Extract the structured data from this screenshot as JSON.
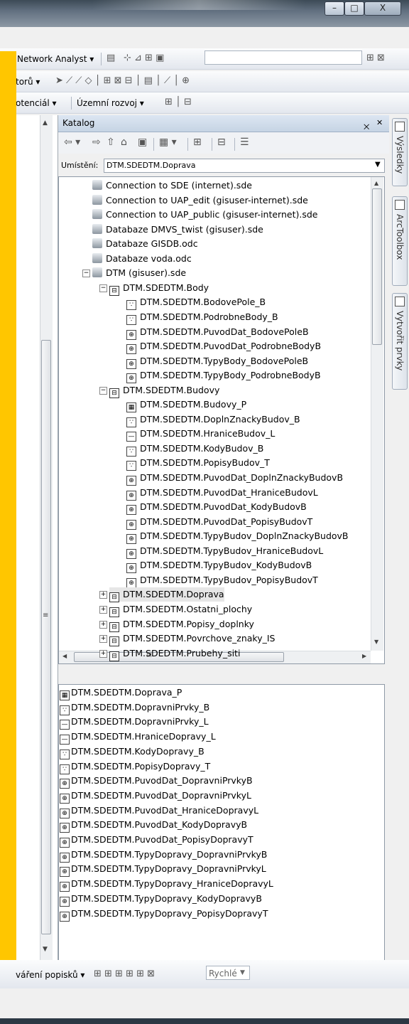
{
  "window": {
    "minimize_glyph": "–",
    "maximize_glyph": "□",
    "close_glyph": "X"
  },
  "toolbar1": {
    "network_analyst": "Network Analyst ▾",
    "scale_combo": ""
  },
  "toolbar2": {
    "label": "torů ▾"
  },
  "toolbar3": {
    "potencial": "otenciál ▾",
    "uzemni_rozvoj": "Územní rozvoj ▾"
  },
  "catalog": {
    "title": "Katalog",
    "pin_glyph": "྾",
    "close_glyph": "✕",
    "location_label": "Umístění:",
    "location_value": "DTM.SDEDTM.Doprava",
    "tree": [
      {
        "label": "Connection to SDE (internet).sde",
        "icon": "db",
        "indent": 0
      },
      {
        "label": "Connection to UAP_edit (gisuser-internet).sde",
        "icon": "db",
        "indent": 0
      },
      {
        "label": "Connection to UAP_public (gisuser-internet).sde",
        "icon": "db",
        "indent": 0
      },
      {
        "label": "Databaze DMVS_twist (gisuser).sde",
        "icon": "db",
        "indent": 0
      },
      {
        "label": "Databaze GISDB.odc",
        "icon": "db",
        "indent": 0
      },
      {
        "label": "Databaze voda.odc",
        "icon": "db",
        "indent": 0
      },
      {
        "label": "DTM (gisuser).sde",
        "icon": "db",
        "indent": 0,
        "expander": "−"
      },
      {
        "label": "DTM.SDEDTM.Body",
        "icon": "fds",
        "indent": 1,
        "expander": "−"
      },
      {
        "label": "DTM.SDEDTM.BodovePole_B",
        "icon": "point",
        "indent": 2
      },
      {
        "label": "DTM.SDEDTM.PodrobneBody_B",
        "icon": "point",
        "indent": 2
      },
      {
        "label": "DTM.SDEDTM.PuvodDat_BodovePoleB",
        "icon": "rel",
        "indent": 2
      },
      {
        "label": "DTM.SDEDTM.PuvodDat_PodrobneBodyB",
        "icon": "rel",
        "indent": 2
      },
      {
        "label": "DTM.SDEDTM.TypyBody_BodovePoleB",
        "icon": "rel",
        "indent": 2
      },
      {
        "label": "DTM.SDEDTM.TypyBody_PodrobneBodyB",
        "icon": "rel",
        "indent": 2
      },
      {
        "label": "DTM.SDEDTM.Budovy",
        "icon": "fds",
        "indent": 1,
        "expander": "−"
      },
      {
        "label": "DTM.SDEDTM.Budovy_P",
        "icon": "poly",
        "indent": 2
      },
      {
        "label": "DTM.SDEDTM.DoplnZnackyBudov_B",
        "icon": "point",
        "indent": 2
      },
      {
        "label": "DTM.SDEDTM.HraniceBudov_L",
        "icon": "line",
        "indent": 2
      },
      {
        "label": "DTM.SDEDTM.KodyBudov_B",
        "icon": "point",
        "indent": 2
      },
      {
        "label": "DTM.SDEDTM.PopisyBudov_T",
        "icon": "point",
        "indent": 2
      },
      {
        "label": "DTM.SDEDTM.PuvodDat_DoplnZnackyBudovB",
        "icon": "rel",
        "indent": 2
      },
      {
        "label": "DTM.SDEDTM.PuvodDat_HraniceBudovL",
        "icon": "rel",
        "indent": 2
      },
      {
        "label": "DTM.SDEDTM.PuvodDat_KodyBudovB",
        "icon": "rel",
        "indent": 2
      },
      {
        "label": "DTM.SDEDTM.PuvodDat_PopisyBudovT",
        "icon": "rel",
        "indent": 2
      },
      {
        "label": "DTM.SDEDTM.TypyBudov_DoplnZnackyBudovB",
        "icon": "rel",
        "indent": 2
      },
      {
        "label": "DTM.SDEDTM.TypyBudov_HraniceBudovL",
        "icon": "rel",
        "indent": 2
      },
      {
        "label": "DTM.SDEDTM.TypyBudov_KodyBudovB",
        "icon": "rel",
        "indent": 2
      },
      {
        "label": "DTM.SDEDTM.TypyBudov_PopisyBudovT",
        "icon": "rel",
        "indent": 2
      },
      {
        "label": "DTM.SDEDTM.Doprava",
        "icon": "fds",
        "indent": 1,
        "expander": "+",
        "selected": true
      },
      {
        "label": "DTM.SDEDTM.Ostatni_plochy",
        "icon": "fds",
        "indent": 1,
        "expander": "+"
      },
      {
        "label": "DTM.SDEDTM.Popisy_doplnky",
        "icon": "fds",
        "indent": 1,
        "expander": "+"
      },
      {
        "label": "DTM.SDEDTM.Povrchove_znaky_IS",
        "icon": "fds",
        "indent": 1,
        "expander": "+"
      },
      {
        "label": "DTM.SDEDTM.Prubehy_siti",
        "icon": "fds",
        "indent": 1,
        "expander": "+"
      }
    ],
    "hscroll_label": "III",
    "contents": [
      {
        "label": "DTM.SDEDTM.Doprava_P",
        "icon": "poly"
      },
      {
        "label": "DTM.SDEDTM.DopravniPrvky_B",
        "icon": "point"
      },
      {
        "label": "DTM.SDEDTM.DopravniPrvky_L",
        "icon": "line"
      },
      {
        "label": "DTM.SDEDTM.HraniceDopravy_L",
        "icon": "line"
      },
      {
        "label": "DTM.SDEDTM.KodyDopravy_B",
        "icon": "point"
      },
      {
        "label": "DTM.SDEDTM.PopisyDopravy_T",
        "icon": "point"
      },
      {
        "label": "DTM.SDEDTM.PuvodDat_DopravniPrvkyB",
        "icon": "rel"
      },
      {
        "label": "DTM.SDEDTM.PuvodDat_DopravniPrvkyL",
        "icon": "rel"
      },
      {
        "label": "DTM.SDEDTM.PuvodDat_HraniceDopravyL",
        "icon": "rel"
      },
      {
        "label": "DTM.SDEDTM.PuvodDat_KodyDopravyB",
        "icon": "rel"
      },
      {
        "label": "DTM.SDEDTM.PuvodDat_PopisyDopravyT",
        "icon": "rel"
      },
      {
        "label": "DTM.SDEDTM.TypyDopravy_DopravniPrvkyB",
        "icon": "rel"
      },
      {
        "label": "DTM.SDEDTM.TypyDopravy_DopravniPrvkyL",
        "icon": "rel"
      },
      {
        "label": "DTM.SDEDTM.TypyDopravy_HraniceDopravyL",
        "icon": "rel"
      },
      {
        "label": "DTM.SDEDTM.TypyDopravy_KodyDopravyB",
        "icon": "rel"
      },
      {
        "label": "DTM.SDEDTM.TypyDopravy_PopisyDopravyT",
        "icon": "rel"
      }
    ]
  },
  "side_tabs": [
    "Výsledky",
    "ArcToolbox",
    "Vytvořit prvky"
  ],
  "bottom": {
    "label": "váření popisků ▾",
    "combo": "Rychlé"
  },
  "icon_glyphs": {
    "point": "∵",
    "line": "—",
    "poly": "▦",
    "rel": "⊕",
    "db": "",
    "fds": "⊟"
  }
}
